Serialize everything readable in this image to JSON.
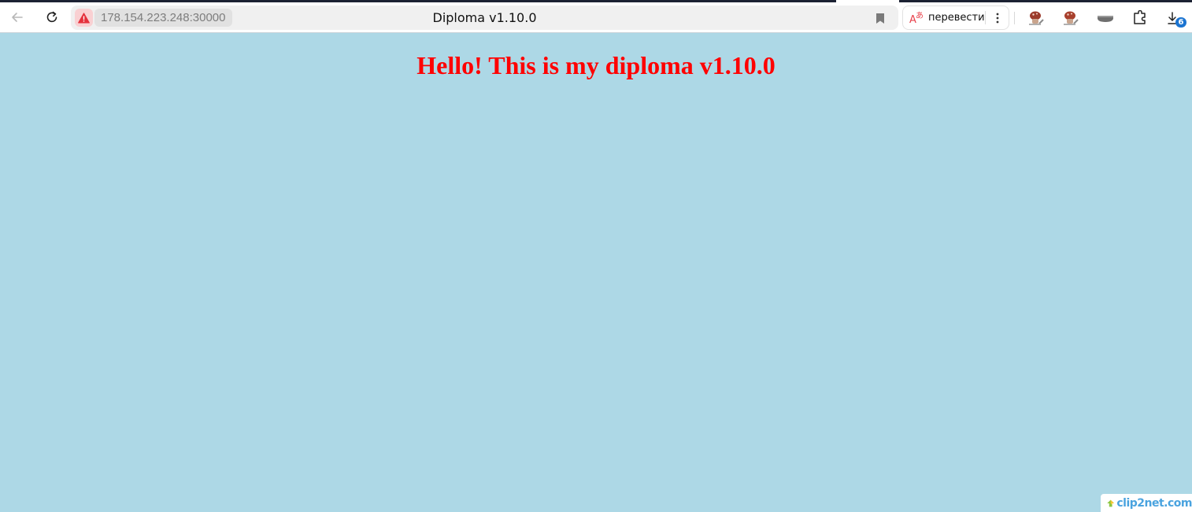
{
  "browser": {
    "url": "178.154.223.248:30000",
    "tab_title": "Diploma v1.10.0",
    "translate_label": "перевести",
    "downloads_count": "6"
  },
  "page": {
    "heading": "Hello! This is my diploma v1.10.0",
    "background_color": "#add8e6",
    "heading_color": "#ff0000"
  },
  "watermark": {
    "text": "clip2net.com"
  },
  "icons": {
    "back": "arrow-left-icon",
    "reload": "reload-icon",
    "security": "warning-icon",
    "bookmark": "bookmark-icon",
    "translate": "translate-icon",
    "more": "more-vertical-icon",
    "downloads": "download-icon"
  }
}
